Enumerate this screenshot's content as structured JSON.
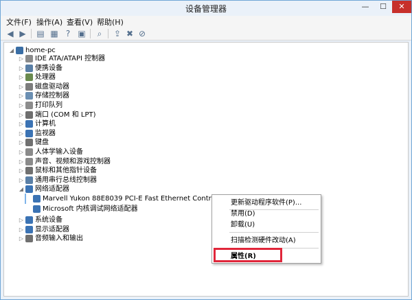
{
  "window": {
    "title": "设备管理器",
    "minimize": "—",
    "maximize": "☐",
    "close": "✕"
  },
  "menu": [
    "文件(F)",
    "操作(A)",
    "查看(V)",
    "帮助(H)"
  ],
  "toolbar_icons": [
    "back-icon",
    "forward-icon",
    "show-hide-console-tree-icon",
    "properties-icon",
    "help-icon",
    "view-icon",
    "scan-hardware-icon",
    "update-driver-icon",
    "uninstall-icon",
    "disable-icon"
  ],
  "tree": {
    "root": "home-pc",
    "items": [
      {
        "label": "IDE ATA/ATAPI 控制器",
        "icon": "ide-controller-icon",
        "color": "#8a8a8a"
      },
      {
        "label": "便携设备",
        "icon": "portable-device-icon",
        "color": "#5a7fa6"
      },
      {
        "label": "处理器",
        "icon": "processor-icon",
        "color": "#6a8a4e"
      },
      {
        "label": "磁盘驱动器",
        "icon": "disk-drive-icon",
        "color": "#7d7d7d"
      },
      {
        "label": "存储控制器",
        "icon": "storage-controller-icon",
        "color": "#6b8fb2"
      },
      {
        "label": "打印队列",
        "icon": "printer-icon",
        "color": "#8c8c8c"
      },
      {
        "label": "端口 (COM 和 LPT)",
        "icon": "port-icon",
        "color": "#6e6e6e"
      },
      {
        "label": "计算机",
        "icon": "computer-icon",
        "color": "#3b73b4"
      },
      {
        "label": "监视器",
        "icon": "monitor-icon",
        "color": "#3b73b4"
      },
      {
        "label": "键盘",
        "icon": "keyboard-icon",
        "color": "#707070"
      },
      {
        "label": "人体学输入设备",
        "icon": "hid-icon",
        "color": "#8a8a8a"
      },
      {
        "label": "声音、视频和游戏控制器",
        "icon": "sound-icon",
        "color": "#8a8a8a"
      },
      {
        "label": "鼠标和其他指针设备",
        "icon": "mouse-icon",
        "color": "#707070"
      },
      {
        "label": "通用串行总线控制器",
        "icon": "usb-icon",
        "color": "#5a7fa6"
      },
      {
        "label": "网络适配器",
        "icon": "network-adapter-icon",
        "color": "#3b73b4"
      }
    ],
    "network_children": [
      {
        "label": "Marvell Yukon 88E8039 PCI-E Fast Ethernet Controller",
        "icon": "network-adapter-icon"
      },
      {
        "label": "Microsoft 内核调试网络适配器",
        "icon": "network-adapter-icon"
      }
    ],
    "after_items": [
      {
        "label": "系统设备",
        "icon": "system-device-icon",
        "color": "#3b73b4"
      },
      {
        "label": "显示适配器",
        "icon": "display-adapter-icon",
        "color": "#3b73b4"
      },
      {
        "label": "音频输入和输出",
        "icon": "audio-io-icon",
        "color": "#707070"
      }
    ]
  },
  "context_menu": {
    "update_driver": "更新驱动程序软件(P)...",
    "disable": "禁用(D)",
    "uninstall": "卸载(U)",
    "scan": "扫描检测硬件改动(A)",
    "properties": "属性(R)"
  },
  "colors": {
    "window_bg": "#eaf1f9",
    "selection": "#dfeefb",
    "highlight_box": "#e0263a",
    "close_button": "#c7302b"
  }
}
